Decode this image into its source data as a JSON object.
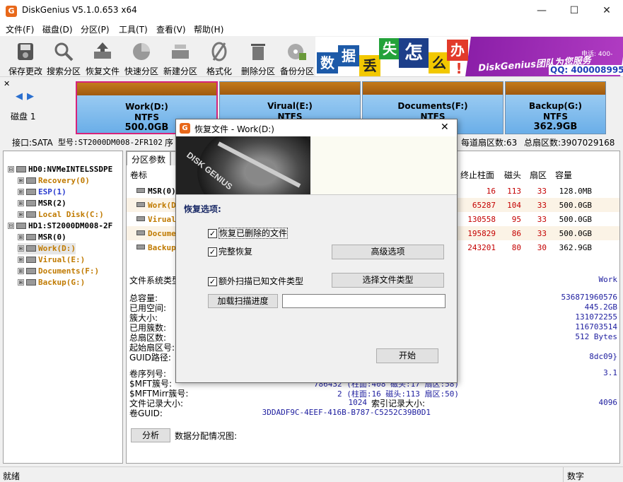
{
  "window": {
    "title": "DiskGenius V5.1.0.653 x64",
    "icon": "G",
    "controls": [
      "—",
      "☐",
      "✕"
    ]
  },
  "menu": [
    "文件(F)",
    "磁盘(D)",
    "分区(P)",
    "工具(T)",
    "查看(V)",
    "帮助(H)"
  ],
  "toolbar": {
    "buttons": [
      "保存更改",
      "搜索分区",
      "恢复文件",
      "快速分区",
      "新建分区",
      "格式化",
      "删除分区",
      "备份分区"
    ]
  },
  "banner": {
    "tiles": [
      "数",
      "据",
      "丢",
      "失",
      "怎",
      "么",
      "办",
      "!"
    ],
    "slogan": "DiskGenius团队为您服务",
    "phone_prefix": "电话: 400-",
    "qq": "QQ: 4000089958"
  },
  "disk_nav": {
    "disk_label": "磁盘 1"
  },
  "partitions": [
    {
      "name": "Work(D:)",
      "fs": "NTFS",
      "size": "500.0GB"
    },
    {
      "name": "Virual(E:)",
      "fs": "NTFS",
      "size": ""
    },
    {
      "name": "Documents(F:)",
      "fs": "NTFS",
      "size": ""
    },
    {
      "name": "Backup(G:)",
      "fs": "NTFS",
      "size": "362.9GB"
    }
  ],
  "disk_info": {
    "iface": "接口:SATA",
    "model": "型号:ST2000DM008-2FR102",
    "serial_prefix": "序",
    "track_sectors": "每道扇区数:63",
    "total_sectors": "总扇区数:3907029168"
  },
  "tree": [
    {
      "label": "HD0:NVMeINTELSSDPE",
      "color": "black",
      "indent": 0,
      "expander": "⊟"
    },
    {
      "label": "Recovery(0)",
      "color": "orange",
      "indent": 1,
      "expander": "⊞"
    },
    {
      "label": "ESP(1)",
      "color": "blue",
      "indent": 1,
      "expander": "⊞"
    },
    {
      "label": "MSR(2)",
      "color": "black",
      "indent": 1,
      "expander": "⊞"
    },
    {
      "label": "Local Disk(C:)",
      "color": "orange",
      "indent": 1,
      "expander": "⊞"
    },
    {
      "label": "HD1:ST2000DM008-2F",
      "color": "black",
      "indent": 0,
      "expander": "⊟"
    },
    {
      "label": "MSR(0)",
      "color": "black",
      "indent": 1,
      "expander": "⊞"
    },
    {
      "label": "Work(D:)",
      "color": "orange",
      "indent": 1,
      "expander": "⊞"
    },
    {
      "label": "Virual(E:)",
      "color": "orange",
      "indent": 1,
      "expander": "⊞"
    },
    {
      "label": "Documents(F:)",
      "color": "orange",
      "indent": 1,
      "expander": "⊞"
    },
    {
      "label": "Backup(G:)",
      "color": "orange",
      "indent": 1,
      "expander": "⊞"
    }
  ],
  "tabs": {
    "params": "分区参数",
    "browse": "浏"
  },
  "table": {
    "headers": {
      "label": "卷标",
      "end_cyl": "终止柱面",
      "head": "磁头",
      "sector": "扇区",
      "capacity": "容量"
    },
    "rows": [
      {
        "label": "MSR(0)",
        "end_cyl": "16",
        "head": "113",
        "sector": "33",
        "capacity": "128.0MB"
      },
      {
        "label": "Work(D:)",
        "end_cyl": "65287",
        "head": "104",
        "sector": "33",
        "capacity": "500.0GB"
      },
      {
        "label": "Virual(E:)",
        "end_cyl": "130558",
        "head": "95",
        "sector": "33",
        "capacity": "500.0GB"
      },
      {
        "label": "Documents(F:)",
        "end_cyl": "195829",
        "head": "86",
        "sector": "33",
        "capacity": "500.0GB"
      },
      {
        "label": "Backup(G:)",
        "end_cyl": "243201",
        "head": "80",
        "sector": "30",
        "capacity": "362.9GB"
      }
    ]
  },
  "fsinfo": {
    "fs_type_label": "文件系统类型:",
    "volume_name": "Work",
    "rows": [
      {
        "label": "总容量:",
        "value": "536871960576"
      },
      {
        "label": "已用空间:",
        "value": "445.2GB"
      },
      {
        "label": "簇大小:",
        "value": "131072255"
      },
      {
        "label": "已用簇数:",
        "value": "116703514"
      },
      {
        "label": "总扇区数:",
        "value": "512 Bytes"
      },
      {
        "label": "起始扇区号:",
        "value": ""
      },
      {
        "label": "GUID路径:",
        "value": "8dc09}"
      }
    ],
    "serial_label": "卷序列号:",
    "serial_ver": "3.1",
    "mft_label": "$MFT簇号:",
    "mft_value": "786432 (柱面:408 磁头:17 扇区:58)",
    "mftmirr_label": "$MFTMirr簇号:",
    "mftmirr_value": "2 (柱面:16 磁头:113 扇区:50)",
    "record_label": "文件记录大小:",
    "record_value": "1024",
    "index_label": "索引记录大小:",
    "index_value": "4096",
    "guid_label": "卷GUID:",
    "guid_value": "3DDADF9C-4EEF-416B-B787-C5252C39B0D1"
  },
  "analyze": {
    "button": "分析",
    "label": "数据分配情况图:"
  },
  "status": {
    "left": "就绪",
    "right": "数字"
  },
  "dialog": {
    "title": "恢复文件 - Work(D:)",
    "icon": "G",
    "close": "✕",
    "art_text": "DISK GENIUS",
    "section": "恢复选项:",
    "opt1": "恢复已删除的文件",
    "opt2": "完整恢复",
    "opt3": "额外扫描已知文件类型",
    "check_mark": "✓",
    "advanced_btn": "高级选项",
    "types_btn": "选择文件类型",
    "load_btn": "加载扫描进度",
    "start_btn": "开始"
  }
}
